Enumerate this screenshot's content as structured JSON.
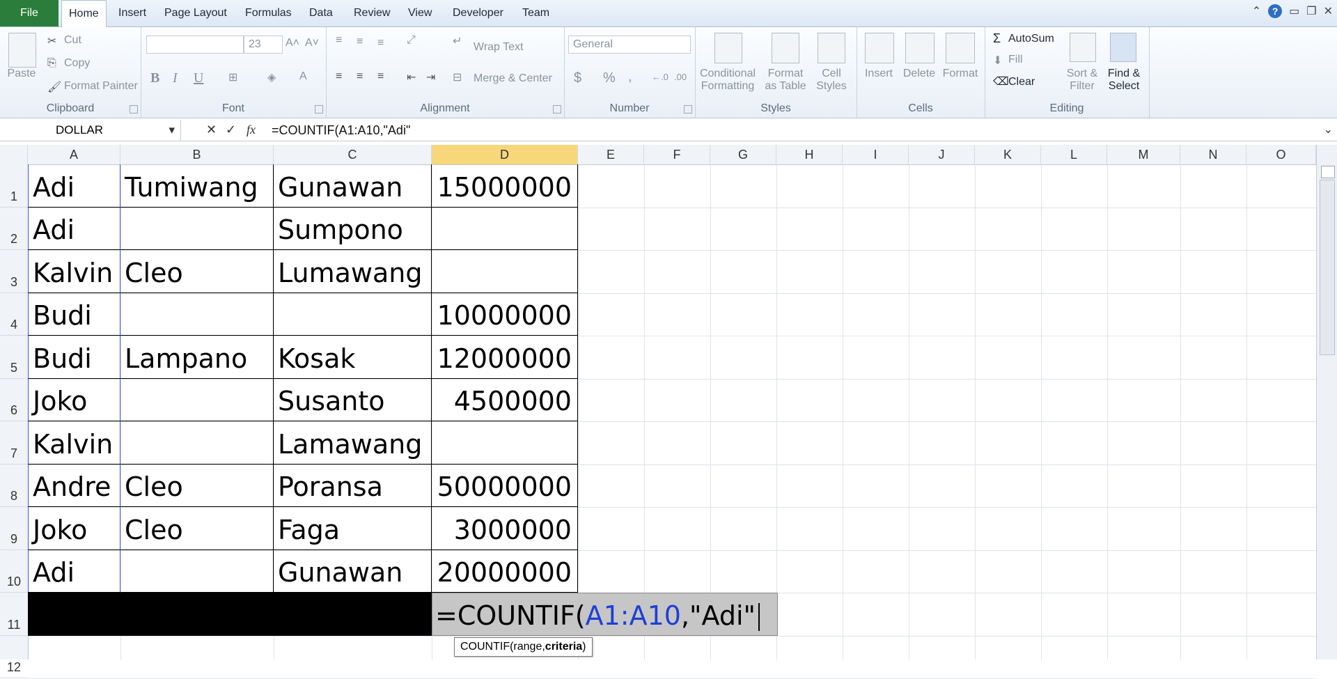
{
  "tabs": {
    "file": "File",
    "home": "Home",
    "insert": "Insert",
    "page_layout": "Page Layout",
    "formulas": "Formulas",
    "data": "Data",
    "review": "Review",
    "view": "View",
    "developer": "Developer",
    "team": "Team"
  },
  "ribbon": {
    "clipboard": {
      "paste": "Paste",
      "cut": "Cut",
      "copy": "Copy",
      "format_painter": "Format Painter",
      "label": "Clipboard"
    },
    "font": {
      "size": "23",
      "label": "Font",
      "bold": "B",
      "italic": "I",
      "underline": "U"
    },
    "alignment": {
      "wrap_text": "Wrap Text",
      "merge_center": "Merge & Center",
      "label": "Alignment"
    },
    "number": {
      "format": "General",
      "currency": "$",
      "percent": "%",
      "comma": ",",
      "label": "Number"
    },
    "styles": {
      "conditional": "Conditional",
      "conditional2": "Formatting",
      "format_table": "Format",
      "format_table2": "as Table",
      "cell_styles": "Cell",
      "cell_styles2": "Styles",
      "label": "Styles"
    },
    "cells": {
      "insert": "Insert",
      "delete": "Delete",
      "format": "Format",
      "label": "Cells"
    },
    "editing": {
      "autosum": "AutoSum",
      "fill": "Fill",
      "clear": "Clear",
      "sort": "Sort &",
      "sort2": "Filter",
      "find": "Find &",
      "find2": "Select",
      "label": "Editing"
    }
  },
  "formula_bar": {
    "name_box": "DOLLAR",
    "formula": "=COUNTIF(A1:A10,\"Adi\""
  },
  "columns": [
    "A",
    "B",
    "C",
    "D",
    "E",
    "F",
    "G",
    "H",
    "I",
    "J",
    "K",
    "L",
    "M",
    "N",
    "O"
  ],
  "rows": [
    "1",
    "2",
    "3",
    "4",
    "5",
    "6",
    "7",
    "8",
    "9",
    "10",
    "11",
    "12"
  ],
  "cells": [
    [
      "Adi",
      "Tumiwang",
      "Gunawan",
      "15000000"
    ],
    [
      "Adi",
      "",
      "Sumpono",
      ""
    ],
    [
      "Kalvin",
      "Cleo",
      "Lumawang",
      ""
    ],
    [
      "Budi",
      "",
      "",
      "10000000"
    ],
    [
      "Budi",
      "Lampano",
      "Kosak",
      "12000000"
    ],
    [
      "Joko",
      "",
      "Susanto",
      "4500000"
    ],
    [
      "Kalvin",
      "",
      "Lamawang",
      ""
    ],
    [
      "Andre",
      "Cleo",
      "Poransa",
      "50000000"
    ],
    [
      "Joko",
      "Cleo",
      "Faga",
      "3000000"
    ],
    [
      "Adi",
      "",
      "Gunawan",
      "20000000"
    ]
  ],
  "edit_cell": {
    "prefix": "=COUNTIF(",
    "range": "A1:A10",
    "suffix": ",\"Adi\""
  },
  "tooltip": {
    "fn": "COUNTIF(range, ",
    "arg": "criteria",
    ")": ")"
  },
  "colors": {
    "file_tab": "#2a7d3a",
    "range_ref": "#1f3fd6",
    "selected_header": "#f7d77a",
    "black_band": "#000000"
  }
}
